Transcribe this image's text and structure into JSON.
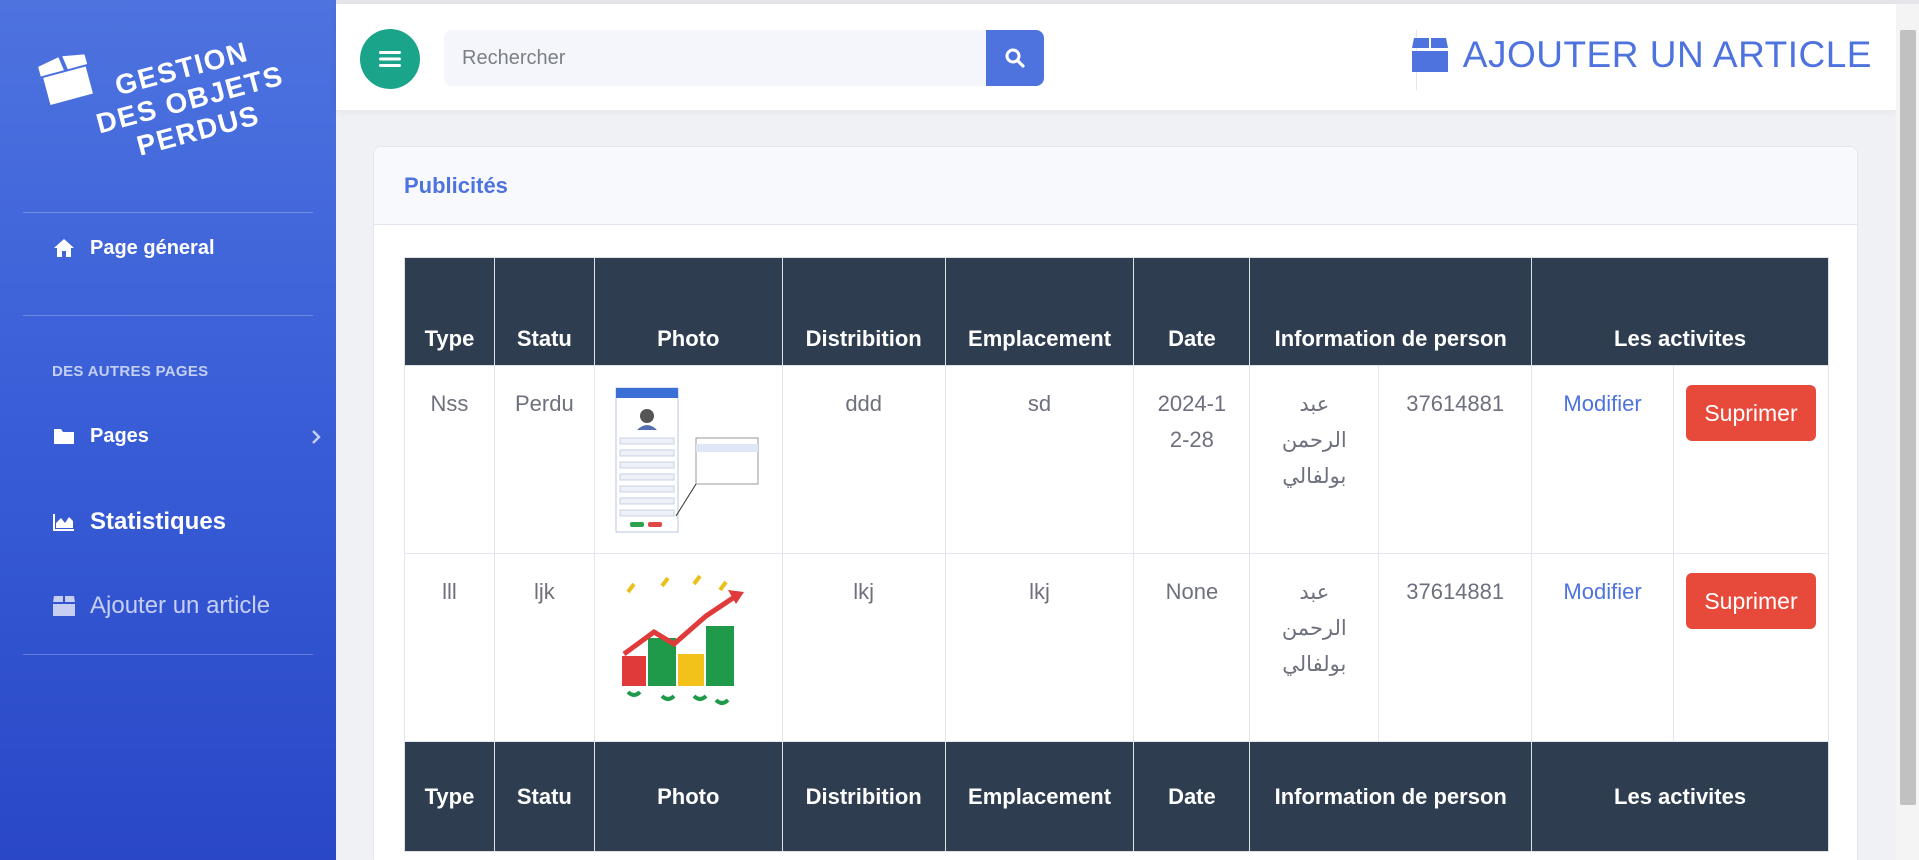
{
  "brand": {
    "line1": "GESTION",
    "line2": "DES OBJETS",
    "line3": "PERDUS"
  },
  "sidebar": {
    "home": "Page géneral",
    "section_heading": "DES AUTRES PAGES",
    "pages": "Pages",
    "stats": "Statistiques",
    "add_article": "Ajouter un article"
  },
  "topbar": {
    "search_placeholder": "Rechercher",
    "add_article": "AJOUTER UN ARTICLE"
  },
  "card": {
    "title": "Publicités"
  },
  "table": {
    "headers": [
      "Type",
      "Statu",
      "Photo",
      "Distribition",
      "Emplacement",
      "Date",
      "Information de person",
      "Les activites"
    ],
    "modify_label": "Modifier",
    "delete_label": "Suprimer",
    "rows": [
      {
        "type": "Nss",
        "statu": "Perdu",
        "photo": "form-screenshot-thumbnail",
        "distribution": "ddd",
        "emplacement": "sd",
        "date": "2024-12-28",
        "person_name": "عبد الرحمن بولفالي",
        "person_phone": "37614881"
      },
      {
        "type": "lll",
        "statu": "ljk",
        "photo": "isms-chart-logo",
        "distribution": "lkj",
        "emplacement": "lkj",
        "date": "None",
        "person_name": "عبد الرحمن بولفالي",
        "person_phone": "37614881"
      }
    ]
  },
  "colors": {
    "primary": "#4e73df",
    "success": "#1aa48a",
    "danger": "#e74a3b",
    "table_head": "#2e3e50"
  }
}
